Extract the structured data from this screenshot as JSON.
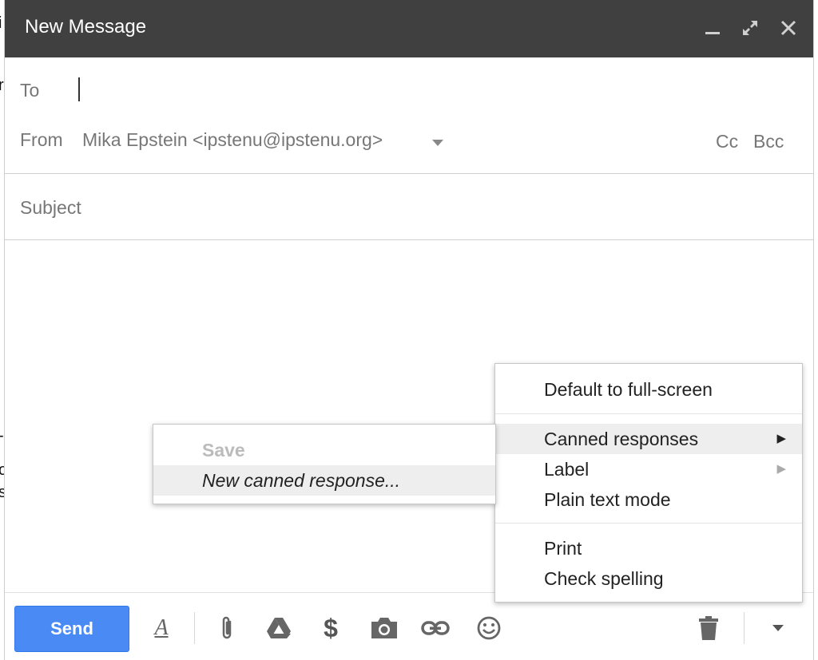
{
  "window": {
    "title": "New Message",
    "minimize_icon": "minimize-icon",
    "expand_icon": "expand-icon",
    "close_icon": "close-icon"
  },
  "page_edge": [
    "i",
    "r",
    "-",
    "o",
    "s"
  ],
  "recipients": {
    "to_label": "To",
    "from_label": "From",
    "from_value": "Mika Epstein <ipstenu@ipstenu.org>",
    "cc_label": "Cc",
    "bcc_label": "Bcc"
  },
  "subject": {
    "placeholder": "Subject",
    "value": ""
  },
  "toolbar": {
    "send_label": "Send",
    "icons": [
      "formatting-icon",
      "attach-icon",
      "drive-icon",
      "money-icon",
      "photo-icon",
      "link-icon",
      "emoji-icon",
      "trash-icon",
      "more-options-icon"
    ],
    "formatting_glyph": "A",
    "money_glyph": "$"
  },
  "more_menu": {
    "items": [
      {
        "label": "Default to full-screen"
      },
      {
        "label": "Canned responses",
        "submenu": true
      },
      {
        "label": "Label",
        "submenu": true
      },
      {
        "label": "Plain text mode"
      },
      {
        "label": "Print"
      },
      {
        "label": "Check spelling"
      }
    ],
    "arrow_glyph": "▶"
  },
  "canned_submenu": {
    "items": [
      {
        "label": "Save",
        "disabled": true
      },
      {
        "label": "New canned response..."
      }
    ]
  },
  "colors": {
    "titlebar": "#404040",
    "send_button": "#4a8af4",
    "menu_highlight": "#eeeeee"
  }
}
